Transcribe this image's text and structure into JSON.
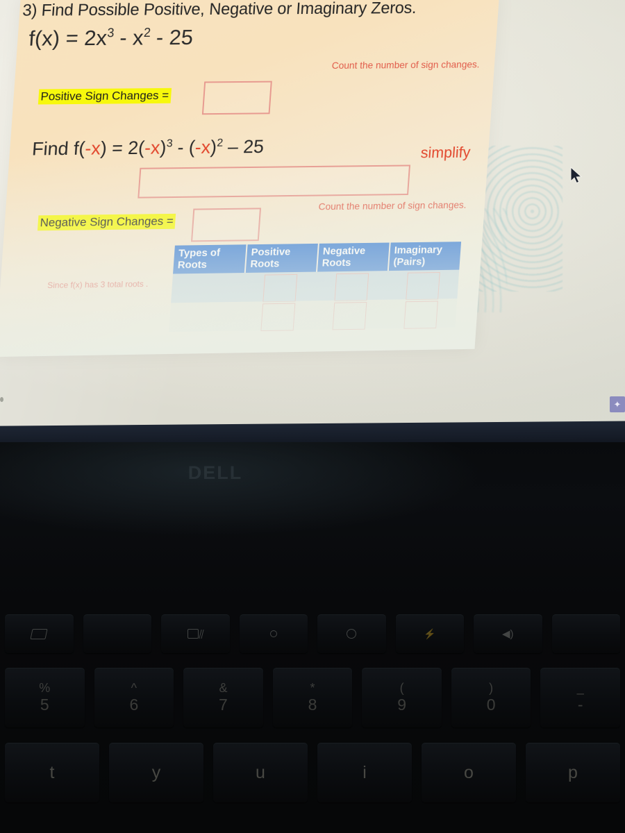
{
  "slide": {
    "question_number_and_prompt": "3) Find Possible Positive, Negative or Imaginary Zeros.",
    "equation_fx": {
      "lead": "f(x)  =  2x",
      "exp1": "3",
      "mid": " - x",
      "exp2": "2",
      "tail": " - 25"
    },
    "hint_positive": "Count the number of sign changes.",
    "label_positive_sign_changes": "Positive Sign Changes =",
    "answer_positive_sign_changes": "",
    "equation_fnegx": {
      "lead": "Find f(",
      "negx1": "-x",
      "eq": ")  = 2(",
      "negx2": "-x",
      "close1": ")",
      "exp1": "3",
      "minus1": " - (",
      "negx3": "-x",
      "close2": ")",
      "exp2": "2",
      "tail": " – 25"
    },
    "simplify_label": "simplify",
    "answer_simplified": "",
    "hint_negative": "Count the number of sign changes.",
    "label_negative_sign_changes": "Negative Sign Changes =",
    "answer_negative_sign_changes": "",
    "note_total_roots": "Since f(x) has 3 total roots .",
    "table": {
      "headers": [
        "Types of Roots",
        "Positive Roots",
        "Negative Roots",
        "Imaginary (Pairs)"
      ],
      "rows": [
        {
          "type": "",
          "positive": "",
          "negative": "",
          "imaginary": ""
        },
        {
          "type": "",
          "positive": "",
          "negative": "",
          "imaginary": ""
        }
      ]
    },
    "colors": {
      "slide_background": "#f8e3bf",
      "header_blue": "#2f76d2",
      "highlight_yellow": "#f7f80c",
      "hint_red": "#e15c4a",
      "box_border": "#e79a90"
    }
  },
  "screen": {
    "cursor_icon": "mouse-pointer-arrow",
    "edge_badge_glyph": "✦"
  },
  "laptop": {
    "brand": "DELL",
    "keyboard": {
      "function_row": [
        {
          "icon": "display-switch-icon"
        },
        {
          "icon": "projector-screen-icon"
        },
        {
          "icon": "brightness-down-icon"
        },
        {
          "icon": "brightness-up-icon"
        },
        {
          "icon": "keyboard-backlight-icon"
        },
        {
          "icon": "volume-mute-icon"
        },
        {
          "icon": "blank-key"
        }
      ],
      "number_row": [
        {
          "shift": "%",
          "base": "5"
        },
        {
          "shift": "^",
          "base": "6"
        },
        {
          "shift": "&",
          "base": "7"
        },
        {
          "shift": "*",
          "base": "8"
        },
        {
          "shift": "(",
          "base": "9"
        },
        {
          "shift": ")",
          "base": "0"
        },
        {
          "shift": "_",
          "base": "-"
        }
      ],
      "letter_row": [
        "t",
        "y",
        "u",
        "i",
        "o",
        "p"
      ]
    }
  }
}
